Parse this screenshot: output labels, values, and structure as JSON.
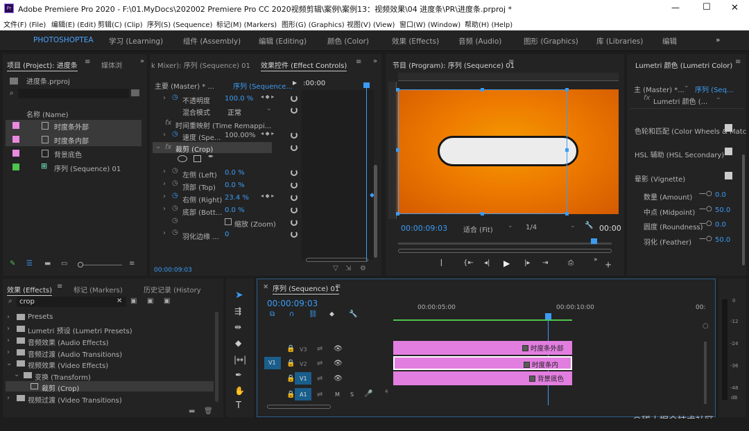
{
  "window": {
    "title": "Adobe Premiere Pro 2020 - F:\\01.MyDocs\\202002 Premiere Pro CC 2020视频剪辑\\案例\\案例13：视频效果\\04 进度条\\PR\\进度条.prproj *",
    "app_icon": "Pr",
    "minimize": "—",
    "maximize": "☐",
    "close": "✕"
  },
  "menu": [
    "文件(F) (File)",
    "编辑(E) (Edit)",
    "剪辑(C) (Clip)",
    "序列(S) (Sequence)",
    "标记(M) (Markers)",
    "图形(G) (Graphics)",
    "视图(V) (View)",
    "窗口(W) (Window)",
    "帮助(H) (Help)"
  ],
  "workspaces": {
    "items": [
      "PHOTOSHOPTEA",
      "学习 (Learning)",
      "组件 (Assembly)",
      "编辑 (Editing)",
      "颜色 (Color)",
      "效果 (Effects)",
      "音频 (Audio)",
      "图形 (Graphics)",
      "库 (Libraries)",
      "编辑"
    ],
    "more": "»"
  },
  "project": {
    "tab": "项目 (Project): 进度条",
    "tab2": "媒体浏",
    "file": "进度条.prproj",
    "col_header": "名称 (Name)",
    "items": [
      {
        "name": "时度条外部",
        "color": "#e88ae0"
      },
      {
        "name": "时度条内部",
        "color": "#e88ae0"
      },
      {
        "name": "背景底色",
        "color": "#e88ae0"
      },
      {
        "name": "序列 (Sequence) 01",
        "color": "#4ec34e"
      }
    ]
  },
  "effect_controls": {
    "tab_mixer": "k Mixer): 序列 (Sequence) 01",
    "tab": "效果控件 (Effect Controls)",
    "master": "主要 (Master) * ...",
    "sequence": "序列 (Sequence...",
    "timecode": ":00:00",
    "opacity_label": "不透明度",
    "opacity_value": "100.0 %",
    "blend_label": "混合模式",
    "blend_value": "正常",
    "time_remap": "时间重映射 (Time Remappi...",
    "speed_label": "速度 (Spe...",
    "speed_value": "100.00%",
    "crop": "裁剪 (Crop)",
    "left_label": "左侧 (Left)",
    "left_value": "0.0 %",
    "top_label": "顶部 (Top)",
    "top_value": "0.0 %",
    "right_label": "右侧 (Right)",
    "right_value": "23.4 %",
    "bottom_label": "底部 (Bott...",
    "bottom_value": "0.0 %",
    "zoom_label": "缩放 (Zoom)",
    "feather_label": "羽化边缘 ...",
    "feather_value": "0",
    "footer_time": "00:00:09:03"
  },
  "program": {
    "tab": "节目 (Program): 序列 (Sequence) 01",
    "timecode": "00:00:09:03",
    "fit": "适合 (Fit)",
    "quality": "1/4",
    "duration": "00:00"
  },
  "lumetri": {
    "tab": "Lumetri 颜色 (Lumetri Color)",
    "master": "主 (Master) *...",
    "seq": "序列 (Seq...",
    "fx": "Lumetri 颜色 (...",
    "wheels": "色轮和匹配 (Color Wheels & Matc",
    "hsl": "HSL 辅助 (HSL Secondary)",
    "vignette": "晕影 (Vignette)",
    "params": [
      {
        "label": "数量 (Amount)",
        "value": "0.0"
      },
      {
        "label": "中点 (Midpoint)",
        "value": "50.0"
      },
      {
        "label": "圆度 (Roundness)",
        "value": "0.0"
      },
      {
        "label": "羽化 (Feather)",
        "value": "50.0"
      }
    ]
  },
  "effects": {
    "tab": "效果 (Effects)",
    "tab2": "标记 (Markers)",
    "tab3": "历史记录 (History",
    "search": "crop",
    "items": [
      {
        "label": "Presets",
        "indent": 0
      },
      {
        "label": "Lumetri 预设 (Lumetri Presets)",
        "indent": 0
      },
      {
        "label": "音频效果 (Audio Effects)",
        "indent": 0
      },
      {
        "label": "音频过渡 (Audio Transitions)",
        "indent": 0
      },
      {
        "label": "视频效果 (Video Effects)",
        "indent": 0
      },
      {
        "label": "变换 (Transform)",
        "indent": 1
      },
      {
        "label": "裁剪 (Crop)",
        "indent": 2
      },
      {
        "label": "视频过渡 (Video Transitions)",
        "indent": 0
      }
    ]
  },
  "timeline": {
    "tab": "序列 (Sequence) 01",
    "timecode": "00:00:09:03",
    "ruler": [
      "00:00:05:00",
      "00:00:10:00",
      "00:"
    ],
    "tracks": [
      {
        "name": "V3"
      },
      {
        "name": "V2"
      },
      {
        "name": "V1"
      },
      {
        "name": "A1"
      }
    ],
    "src_v": "V1",
    "src_a": "A1",
    "clips": [
      {
        "name": "时度条外部"
      },
      {
        "name": "时度条内"
      },
      {
        "name": "背景底色"
      }
    ],
    "a1_buttons": [
      "M",
      "S"
    ],
    "a1_num": "4"
  },
  "meter": {
    "labels": [
      "0",
      "-12",
      "-24",
      "-36",
      "-48",
      "dB"
    ]
  },
  "watermark": "@稀土掘金技术社区",
  "colors": {
    "accent": "#3b9cf5",
    "clip": "#e27ee0",
    "orange": "#f07a00",
    "track_blue": "#1a5e8c"
  }
}
